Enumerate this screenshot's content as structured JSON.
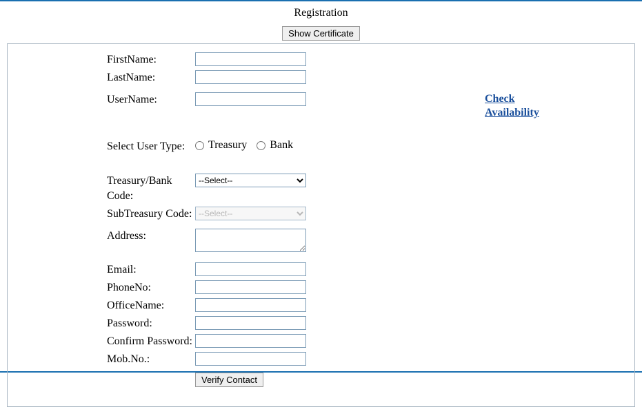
{
  "title": "Registration",
  "buttons": {
    "show_certificate": "Show Certificate",
    "verify_contact": "Verify Contact"
  },
  "labels": {
    "first_name": "FirstName:",
    "last_name": "LastName:",
    "user_name": "UserName:",
    "select_user_type": "Select User Type:",
    "treasury_bank_code": "Treasury/Bank Code:",
    "subtreasury_code": "SubTreasury Code:",
    "address": "Address:",
    "email": "Email:",
    "phone_no": "PhoneNo:",
    "office_name": "OfficeName:",
    "password": "Password:",
    "confirm_password": "Confirm Password:",
    "mob_no": "Mob.No.:"
  },
  "user_type_options": {
    "treasury": "Treasury",
    "bank": "Bank"
  },
  "select_placeholder": "--Select--",
  "links": {
    "check_availability": "Check Availability"
  },
  "values": {
    "first_name": "",
    "last_name": "",
    "user_name": "",
    "treasury_bank_code": "--Select--",
    "subtreasury_code": "--Select--",
    "address": "",
    "email": "",
    "phone_no": "",
    "office_name": "",
    "password": "",
    "confirm_password": "",
    "mob_no": ""
  }
}
